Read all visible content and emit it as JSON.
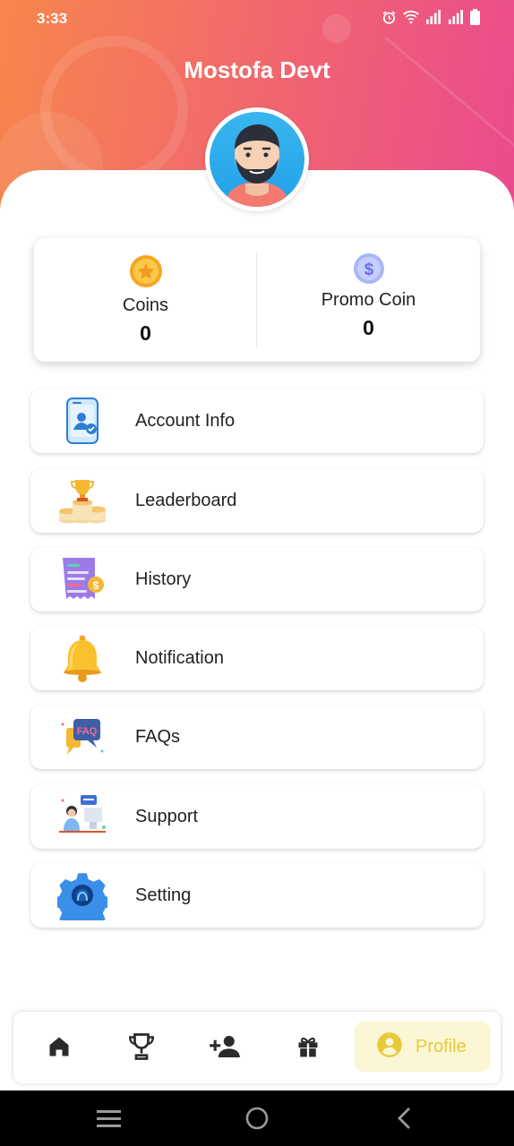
{
  "status_bar": {
    "time": "3:33",
    "icons": [
      "alarm-icon",
      "wifi-icon",
      "signal-icon",
      "signal-icon",
      "battery-icon"
    ]
  },
  "profile": {
    "name": "Mostofa Devt"
  },
  "balances": {
    "coins": {
      "label": "Coins",
      "value": "0",
      "icon": "coin-star-icon"
    },
    "promo": {
      "label": "Promo Coin",
      "value": "0",
      "icon": "promo-dollar-coin-icon"
    }
  },
  "menu": [
    {
      "label": "Account Info",
      "icon": "account-info-icon"
    },
    {
      "label": "Leaderboard",
      "icon": "trophy-coins-icon"
    },
    {
      "label": "History",
      "icon": "receipt-history-icon"
    },
    {
      "label": "Notification",
      "icon": "bell-icon"
    },
    {
      "label": "FAQs",
      "icon": "faq-chat-icon"
    },
    {
      "label": "Support",
      "icon": "support-agent-icon"
    },
    {
      "label": "Setting",
      "icon": "settings-gear-icon"
    }
  ],
  "bottom_nav": {
    "items": [
      "home-icon",
      "trophy-icon",
      "add-user-icon",
      "gift-icon"
    ],
    "active": {
      "label": "Profile",
      "icon": "profile-icon"
    }
  },
  "colors": {
    "header_gradient_start": "#f7874c",
    "header_gradient_end": "#ea4a8e",
    "profile_tab_bg": "#fbf6d4",
    "profile_tab_accent": "#e8c93a"
  }
}
